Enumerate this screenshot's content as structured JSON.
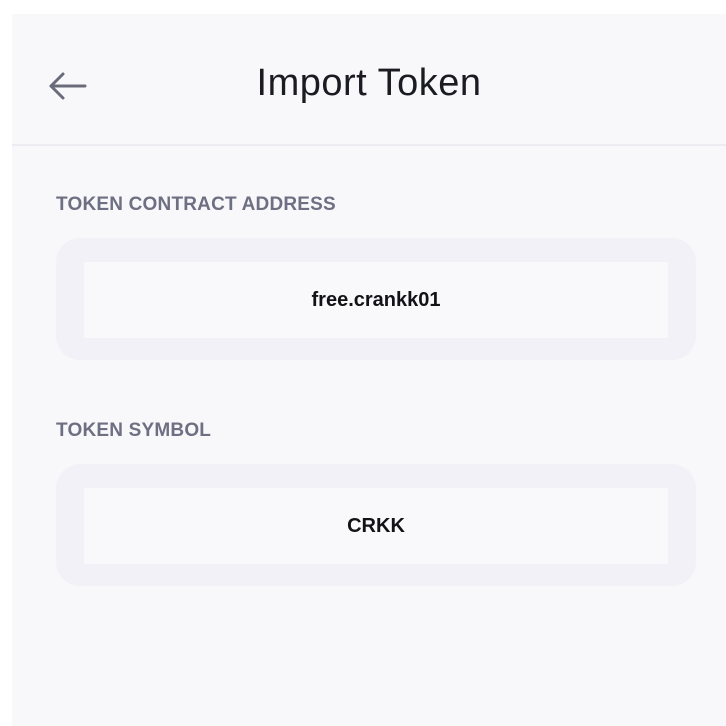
{
  "header": {
    "title": "Import Token",
    "back_icon": "arrow-left-icon"
  },
  "form": {
    "contract_address": {
      "label": "TOKEN CONTRACT ADDRESS",
      "value": "free.crankk01"
    },
    "token_symbol": {
      "label": "TOKEN SYMBOL",
      "value": "CRKK"
    }
  },
  "colors": {
    "background": "#f8f8fb",
    "field_outer": "#f1f1f7",
    "field_inner": "#f9f9fc",
    "label": "#6e6f82",
    "title": "#1b1b22",
    "divider": "#ececf2"
  }
}
